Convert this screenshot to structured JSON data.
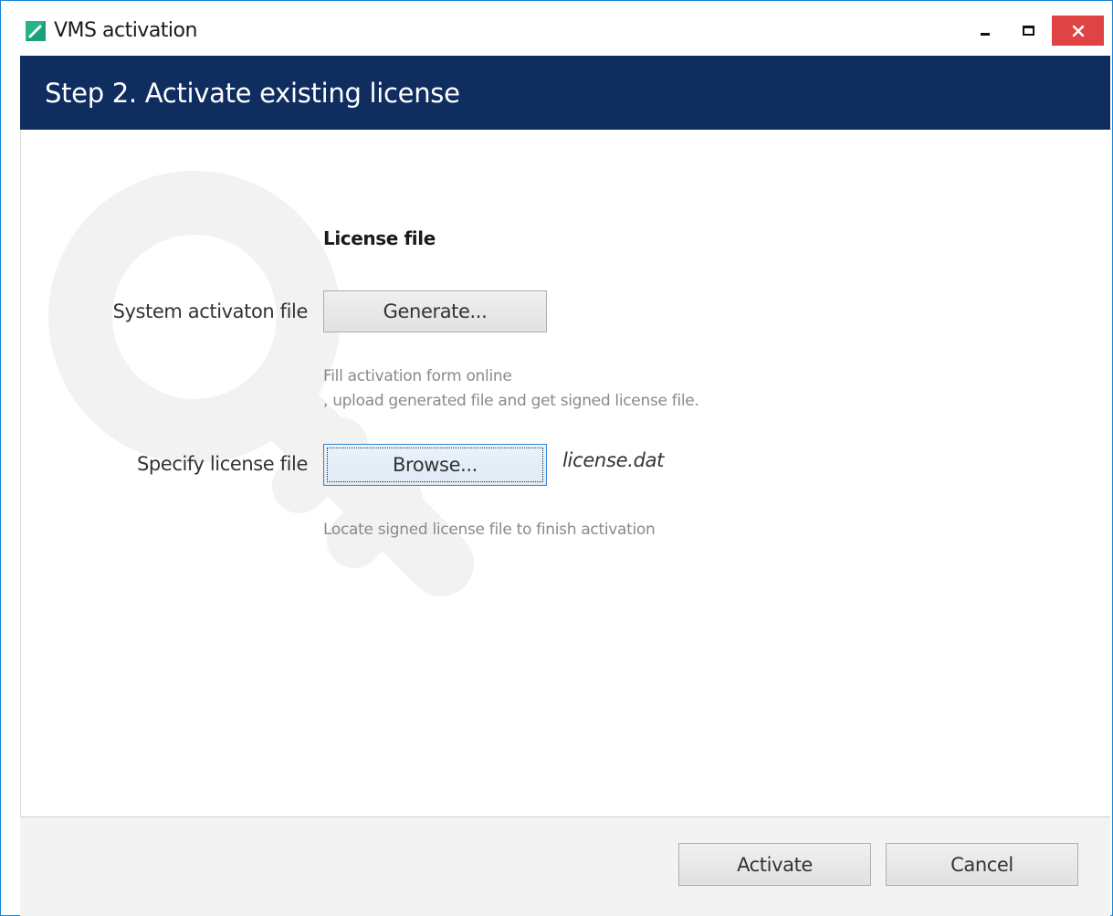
{
  "window": {
    "title": "VMS activation",
    "accent_color": "#1883d7",
    "close_color": "#e04343"
  },
  "header": {
    "title": "Step 2. Activate existing license",
    "background_color": "#0f2d5f"
  },
  "form": {
    "section_heading": "License file",
    "activation_row": {
      "label": "System activaton file",
      "button_label": "Generate...",
      "hint_line1": "Fill activation form online",
      "hint_line2": ", upload generated file and get signed license file."
    },
    "license_row": {
      "label": "Specify license file",
      "button_label": "Browse...",
      "selected_file": "license.dat",
      "hint": "Locate signed license file to finish activation"
    }
  },
  "footer": {
    "activate_label": "Activate",
    "cancel_label": "Cancel"
  },
  "icons": {
    "app": "vms-app-icon",
    "watermark": "key-icon",
    "minimize": "minimize-icon",
    "maximize": "maximize-icon",
    "close": "close-icon"
  }
}
